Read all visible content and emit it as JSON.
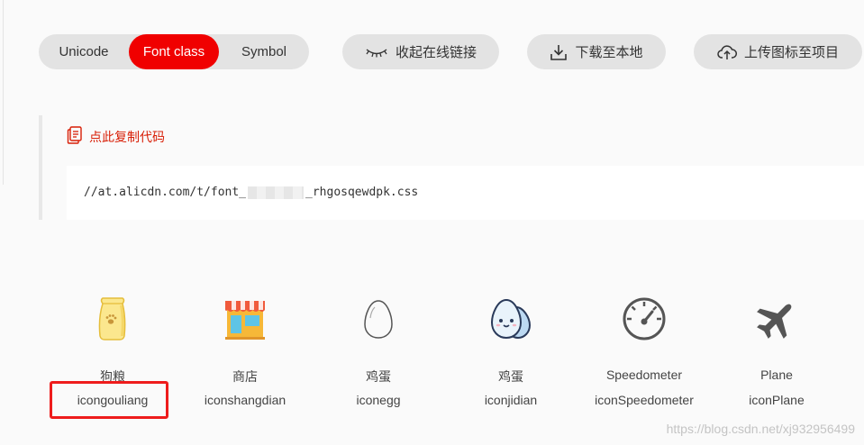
{
  "toolbar": {
    "tabs": [
      {
        "label": "Unicode"
      },
      {
        "label": "Font class"
      },
      {
        "label": "Symbol"
      }
    ],
    "active_tab": "Font class",
    "collapse_label": "收起在线链接",
    "download_label": "下载至本地",
    "upload_label": "上传图标至项目"
  },
  "code_panel": {
    "copy_label": "点此复制代码",
    "url_prefix": "//at.alicdn.com/t/font_",
    "url_suffix": "_rhgosqewdpk.css"
  },
  "icons": [
    {
      "name": "狗粮",
      "code": "icongouliang",
      "icon": "dog-food-icon"
    },
    {
      "name": "商店",
      "code": "iconshangdian",
      "icon": "shop-icon"
    },
    {
      "name": "鸡蛋",
      "code": "iconegg",
      "icon": "egg-icon"
    },
    {
      "name": "鸡蛋",
      "code": "iconjidian",
      "icon": "egg-face-icon"
    },
    {
      "name": "Speedometer",
      "code": "iconSpeedometer",
      "icon": "speedometer-icon"
    },
    {
      "name": "Plane",
      "code": "iconPlane",
      "icon": "plane-icon"
    }
  ],
  "watermark": "https://blog.csdn.net/xj932956499",
  "colors": {
    "accent": "#f00000",
    "highlight_box": "#ee1c1c",
    "copy_link": "#d81e06"
  }
}
